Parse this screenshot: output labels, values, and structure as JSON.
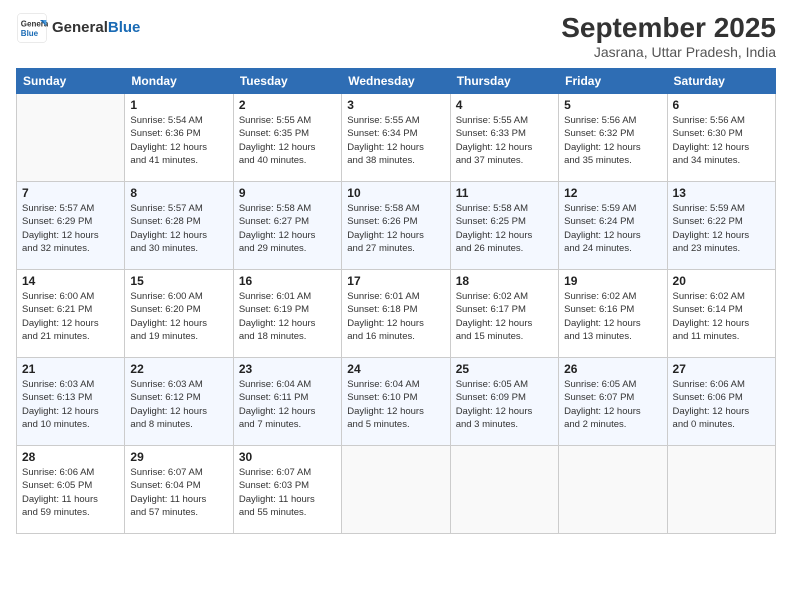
{
  "logo": {
    "line1": "General",
    "line2": "Blue"
  },
  "title": "September 2025",
  "location": "Jasrana, Uttar Pradesh, India",
  "headers": [
    "Sunday",
    "Monday",
    "Tuesday",
    "Wednesday",
    "Thursday",
    "Friday",
    "Saturday"
  ],
  "rows": [
    [
      {
        "day": "",
        "info": ""
      },
      {
        "day": "1",
        "info": "Sunrise: 5:54 AM\nSunset: 6:36 PM\nDaylight: 12 hours\nand 41 minutes."
      },
      {
        "day": "2",
        "info": "Sunrise: 5:55 AM\nSunset: 6:35 PM\nDaylight: 12 hours\nand 40 minutes."
      },
      {
        "day": "3",
        "info": "Sunrise: 5:55 AM\nSunset: 6:34 PM\nDaylight: 12 hours\nand 38 minutes."
      },
      {
        "day": "4",
        "info": "Sunrise: 5:55 AM\nSunset: 6:33 PM\nDaylight: 12 hours\nand 37 minutes."
      },
      {
        "day": "5",
        "info": "Sunrise: 5:56 AM\nSunset: 6:32 PM\nDaylight: 12 hours\nand 35 minutes."
      },
      {
        "day": "6",
        "info": "Sunrise: 5:56 AM\nSunset: 6:30 PM\nDaylight: 12 hours\nand 34 minutes."
      }
    ],
    [
      {
        "day": "7",
        "info": "Sunrise: 5:57 AM\nSunset: 6:29 PM\nDaylight: 12 hours\nand 32 minutes."
      },
      {
        "day": "8",
        "info": "Sunrise: 5:57 AM\nSunset: 6:28 PM\nDaylight: 12 hours\nand 30 minutes."
      },
      {
        "day": "9",
        "info": "Sunrise: 5:58 AM\nSunset: 6:27 PM\nDaylight: 12 hours\nand 29 minutes."
      },
      {
        "day": "10",
        "info": "Sunrise: 5:58 AM\nSunset: 6:26 PM\nDaylight: 12 hours\nand 27 minutes."
      },
      {
        "day": "11",
        "info": "Sunrise: 5:58 AM\nSunset: 6:25 PM\nDaylight: 12 hours\nand 26 minutes."
      },
      {
        "day": "12",
        "info": "Sunrise: 5:59 AM\nSunset: 6:24 PM\nDaylight: 12 hours\nand 24 minutes."
      },
      {
        "day": "13",
        "info": "Sunrise: 5:59 AM\nSunset: 6:22 PM\nDaylight: 12 hours\nand 23 minutes."
      }
    ],
    [
      {
        "day": "14",
        "info": "Sunrise: 6:00 AM\nSunset: 6:21 PM\nDaylight: 12 hours\nand 21 minutes."
      },
      {
        "day": "15",
        "info": "Sunrise: 6:00 AM\nSunset: 6:20 PM\nDaylight: 12 hours\nand 19 minutes."
      },
      {
        "day": "16",
        "info": "Sunrise: 6:01 AM\nSunset: 6:19 PM\nDaylight: 12 hours\nand 18 minutes."
      },
      {
        "day": "17",
        "info": "Sunrise: 6:01 AM\nSunset: 6:18 PM\nDaylight: 12 hours\nand 16 minutes."
      },
      {
        "day": "18",
        "info": "Sunrise: 6:02 AM\nSunset: 6:17 PM\nDaylight: 12 hours\nand 15 minutes."
      },
      {
        "day": "19",
        "info": "Sunrise: 6:02 AM\nSunset: 6:16 PM\nDaylight: 12 hours\nand 13 minutes."
      },
      {
        "day": "20",
        "info": "Sunrise: 6:02 AM\nSunset: 6:14 PM\nDaylight: 12 hours\nand 11 minutes."
      }
    ],
    [
      {
        "day": "21",
        "info": "Sunrise: 6:03 AM\nSunset: 6:13 PM\nDaylight: 12 hours\nand 10 minutes."
      },
      {
        "day": "22",
        "info": "Sunrise: 6:03 AM\nSunset: 6:12 PM\nDaylight: 12 hours\nand 8 minutes."
      },
      {
        "day": "23",
        "info": "Sunrise: 6:04 AM\nSunset: 6:11 PM\nDaylight: 12 hours\nand 7 minutes."
      },
      {
        "day": "24",
        "info": "Sunrise: 6:04 AM\nSunset: 6:10 PM\nDaylight: 12 hours\nand 5 minutes."
      },
      {
        "day": "25",
        "info": "Sunrise: 6:05 AM\nSunset: 6:09 PM\nDaylight: 12 hours\nand 3 minutes."
      },
      {
        "day": "26",
        "info": "Sunrise: 6:05 AM\nSunset: 6:07 PM\nDaylight: 12 hours\nand 2 minutes."
      },
      {
        "day": "27",
        "info": "Sunrise: 6:06 AM\nSunset: 6:06 PM\nDaylight: 12 hours\nand 0 minutes."
      }
    ],
    [
      {
        "day": "28",
        "info": "Sunrise: 6:06 AM\nSunset: 6:05 PM\nDaylight: 11 hours\nand 59 minutes."
      },
      {
        "day": "29",
        "info": "Sunrise: 6:07 AM\nSunset: 6:04 PM\nDaylight: 11 hours\nand 57 minutes."
      },
      {
        "day": "30",
        "info": "Sunrise: 6:07 AM\nSunset: 6:03 PM\nDaylight: 11 hours\nand 55 minutes."
      },
      {
        "day": "",
        "info": ""
      },
      {
        "day": "",
        "info": ""
      },
      {
        "day": "",
        "info": ""
      },
      {
        "day": "",
        "info": ""
      }
    ]
  ]
}
